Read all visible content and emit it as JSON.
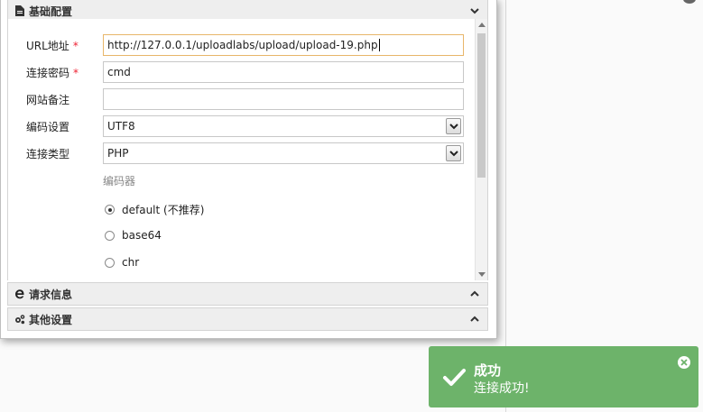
{
  "panels": {
    "basic": {
      "title": "基础配置"
    },
    "request": {
      "title": "请求信息"
    },
    "other": {
      "title": "其他设置"
    }
  },
  "form": {
    "url": {
      "label": "URL地址",
      "required_mark": "*",
      "value": "http://127.0.0.1/uploadlabs/upload/upload-19.php"
    },
    "password": {
      "label": "连接密码",
      "required_mark": "*",
      "value": "cmd"
    },
    "note": {
      "label": "网站备注",
      "value": ""
    },
    "encoding": {
      "label": "编码设置",
      "value": "UTF8"
    },
    "conn_type": {
      "label": "连接类型",
      "value": "PHP"
    },
    "encoder": {
      "title": "编码器",
      "options": [
        "default (不推荐)",
        "base64",
        "chr"
      ],
      "selected": "default (不推荐)"
    }
  },
  "toast": {
    "title": "成功",
    "message": "连接成功!",
    "color": "#6db36a"
  },
  "icons": [
    "file-icon",
    "chevron-down-icon",
    "ie-icon",
    "chevron-up-icon",
    "cogs-icon",
    "check-icon",
    "close-icon"
  ]
}
